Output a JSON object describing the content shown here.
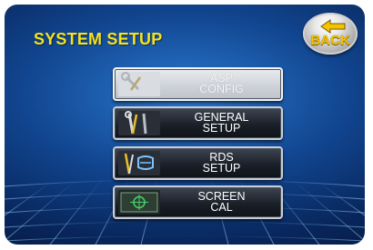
{
  "header": {
    "title": "SYSTEM SETUP"
  },
  "back_button": {
    "label": "BACK"
  },
  "menu": [
    {
      "id": "asp-config",
      "line1": "ASP",
      "line2": "CONFIG",
      "enabled": false,
      "icon": "wrench-screwdriver-icon"
    },
    {
      "id": "general-setup",
      "line1": "GENERAL",
      "line2": "SETUP",
      "enabled": true,
      "icon": "tools-icon"
    },
    {
      "id": "rds-setup",
      "line1": "RDS",
      "line2": "SETUP",
      "enabled": true,
      "icon": "rds-tools-icon"
    },
    {
      "id": "screen-cal",
      "line1": "SCREEN",
      "line2": "CAL",
      "enabled": true,
      "icon": "crosshair-target-icon"
    }
  ],
  "colors": {
    "title": "#f5e21a",
    "back_text": "#f2c400",
    "background": "#11458f"
  }
}
